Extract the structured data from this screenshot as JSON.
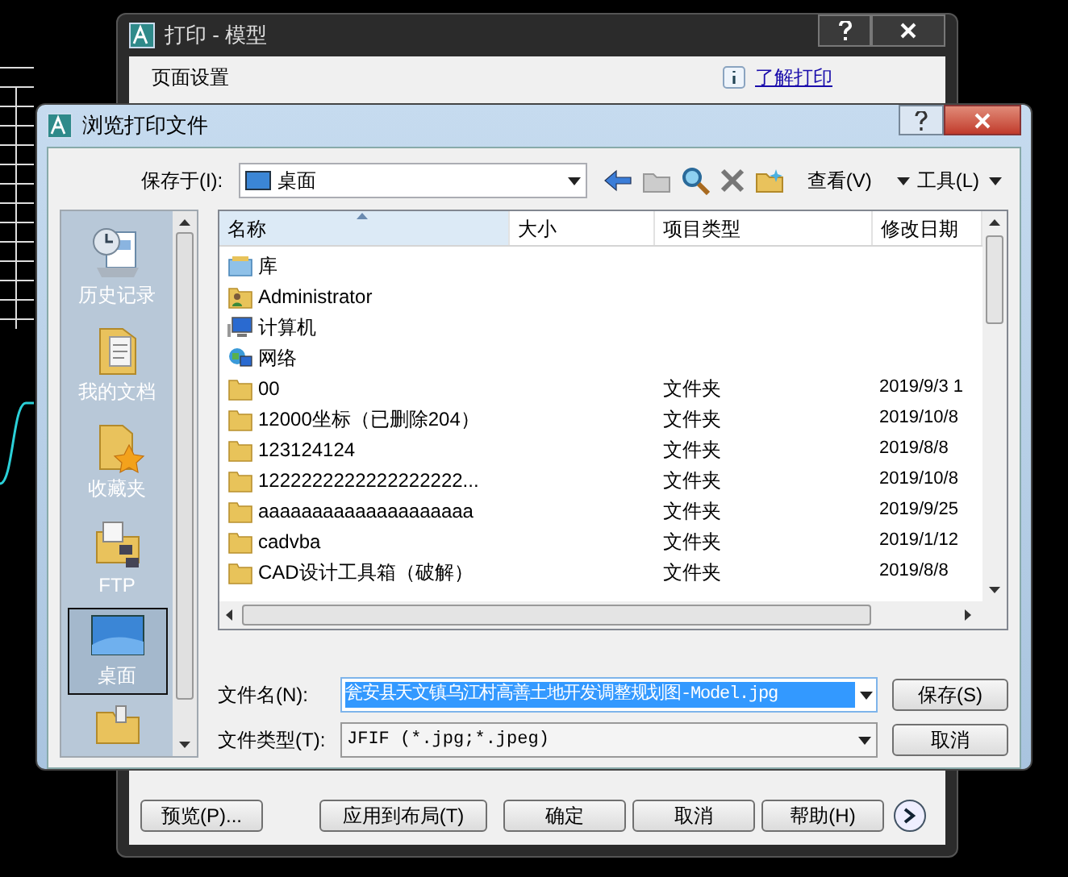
{
  "print_dialog": {
    "title": "打印 - 模型",
    "help_link": "了解打印",
    "section_label": "页面设置",
    "buttons": [
      {
        "label": "预览(P)..."
      },
      {
        "label": "应用到布局(T)"
      },
      {
        "label": "确定"
      },
      {
        "label": "取消"
      },
      {
        "label": "帮助(H)"
      }
    ]
  },
  "browse_dialog": {
    "title": "浏览打印文件",
    "save_in": {
      "label": "保存于(I):",
      "value": "桌面"
    },
    "toolbar": {
      "view": "查看(V)",
      "tools": "工具(L)"
    },
    "places": [
      {
        "label": "历史记录",
        "kind": "history",
        "selected": false
      },
      {
        "label": "我的文档",
        "kind": "documents",
        "selected": false
      },
      {
        "label": "收藏夹",
        "kind": "favorites",
        "selected": false
      },
      {
        "label": "FTP",
        "kind": "ftp",
        "selected": false
      },
      {
        "label": "桌面",
        "kind": "desktop",
        "selected": true
      },
      {
        "kind": "folder",
        "selected": false
      }
    ],
    "columns": [
      "名称",
      "大小",
      "项目类型",
      "修改日期"
    ],
    "files": [
      {
        "kind": "library",
        "name": "库"
      },
      {
        "kind": "user",
        "name": "Administrator"
      },
      {
        "kind": "computer",
        "name": "计算机"
      },
      {
        "kind": "network",
        "name": "网络"
      },
      {
        "kind": "folder",
        "name": "00",
        "type": "文件夹",
        "date": "2019/9/3 1"
      },
      {
        "kind": "folder",
        "name": "12000坐标（已删除204）",
        "type": "文件夹",
        "date": "2019/10/8"
      },
      {
        "kind": "folder",
        "name": "123124124",
        "type": "文件夹",
        "date": "2019/8/8"
      },
      {
        "kind": "folder",
        "name": "1222222222222222222...",
        "type": "文件夹",
        "date": "2019/10/8"
      },
      {
        "kind": "folder",
        "name": "aaaaaaaaaaaaaaaaaaaa",
        "type": "文件夹",
        "date": "2019/9/25"
      },
      {
        "kind": "folder",
        "name": "cadvba",
        "type": "文件夹",
        "date": "2019/1/12"
      },
      {
        "kind": "folder",
        "name": "CAD设计工具箱（破解）",
        "type": "文件夹",
        "date": "2019/8/8"
      }
    ],
    "file_name": {
      "label": "文件名(N):",
      "value": "瓮安县天文镇乌江村高善土地开发调整规划图-Model.jpg",
      "highlighted": true
    },
    "file_type": {
      "label": "文件类型(T):",
      "value": "JFIF (*.jpg;*.jpeg)"
    },
    "buttons": [
      {
        "label": "保存(S)"
      },
      {
        "label": "取消"
      }
    ]
  }
}
